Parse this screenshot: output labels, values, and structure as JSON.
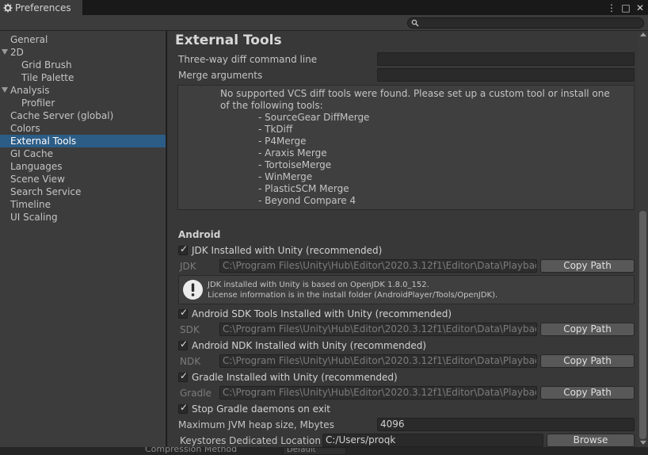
{
  "window": {
    "tab_title": "Preferences",
    "icons": {
      "tab": "gear-icon",
      "menu": "kebab-menu-icon",
      "maximize": "maximize-icon",
      "close": "close-icon"
    },
    "menu_glyph": "⋮",
    "maximize_glyph": "□",
    "close_glyph": "✕"
  },
  "search": {
    "placeholder": "",
    "icon": "search-icon"
  },
  "sidebar": {
    "items": [
      {
        "label": "General"
      },
      {
        "label": "2D",
        "expanded": true
      },
      {
        "label": "Grid Brush"
      },
      {
        "label": "Tile Palette"
      },
      {
        "label": "Analysis",
        "expanded": true
      },
      {
        "label": "Profiler"
      },
      {
        "label": "Cache Server (global)"
      },
      {
        "label": "Colors"
      },
      {
        "label": "External Tools",
        "selected": true
      },
      {
        "label": "GI Cache"
      },
      {
        "label": "Languages"
      },
      {
        "label": "Scene View"
      },
      {
        "label": "Search Service"
      },
      {
        "label": "Timeline"
      },
      {
        "label": "UI Scaling"
      }
    ],
    "selection_color": "#2c5d87"
  },
  "main": {
    "title": "External Tools",
    "diff_command_label": "Three-way diff command line",
    "diff_command_value": "",
    "merge_args_label": "Merge arguments",
    "merge_args_value": "",
    "vcs_message": "No supported VCS diff tools were found. Please set up a custom tool or install one of the following tools:",
    "vcs_tools": [
      "- SourceGear DiffMerge",
      "- TkDiff",
      "- P4Merge",
      "- Araxis Merge",
      "- TortoiseMerge",
      "- WinMerge",
      "- PlasticSCM Merge",
      "- Beyond Compare 4"
    ],
    "android": {
      "section_title": "Android",
      "jdk": {
        "checkbox_label": "JDK Installed with Unity (recommended)",
        "checked": true,
        "field_label": "JDK",
        "path": "C:\\Program Files\\Unity\\Hub\\Editor\\2020.3.12f1\\Editor\\Data\\PlaybackEngines\\AndroidPlayer\\OpenJDK",
        "copy_label": "Copy Path",
        "notice_line1": "JDK installed with Unity is based on OpenJDK 1.8.0_152.",
        "notice_line2": "License information is in the install folder (AndroidPlayer/Tools/OpenJDK).",
        "notice_icon": "warning-icon"
      },
      "sdk": {
        "checkbox_label": "Android SDK Tools Installed with Unity (recommended)",
        "checked": true,
        "field_label": "SDK",
        "path": "C:\\Program Files\\Unity\\Hub\\Editor\\2020.3.12f1\\Editor\\Data\\PlaybackEngines\\AndroidPlayer\\SDK",
        "copy_label": "Copy Path"
      },
      "ndk": {
        "checkbox_label": "Android NDK Installed with Unity (recommended)",
        "checked": true,
        "field_label": "NDK",
        "path": "C:\\Program Files\\Unity\\Hub\\Editor\\2020.3.12f1\\Editor\\Data\\PlaybackEngines\\AndroidPlayer\\NDK",
        "copy_label": "Copy Path"
      },
      "gradle": {
        "checkbox_label": "Gradle Installed with Unity (recommended)",
        "checked": true,
        "field_label": "Gradle",
        "path": "C:\\Program Files\\Unity\\Hub\\Editor\\2020.3.12f1\\Editor\\Data\\PlaybackEngines\\AndroidPlayer\\Tools\\gradle",
        "copy_label": "Copy Path"
      },
      "stop_gradle_label": "Stop Gradle daemons on exit",
      "stop_gradle_checked": true,
      "jvm_heap_label": "Maximum JVM heap size, Mbytes",
      "jvm_heap_value": "4096",
      "keystores_label": "Keystores Dedicated Location",
      "keystores_value": "C:/Users/proqk",
      "browse_label": "Browse"
    }
  },
  "bottom_strip": {
    "left_text": "Compression Method",
    "right_text": "Default"
  }
}
